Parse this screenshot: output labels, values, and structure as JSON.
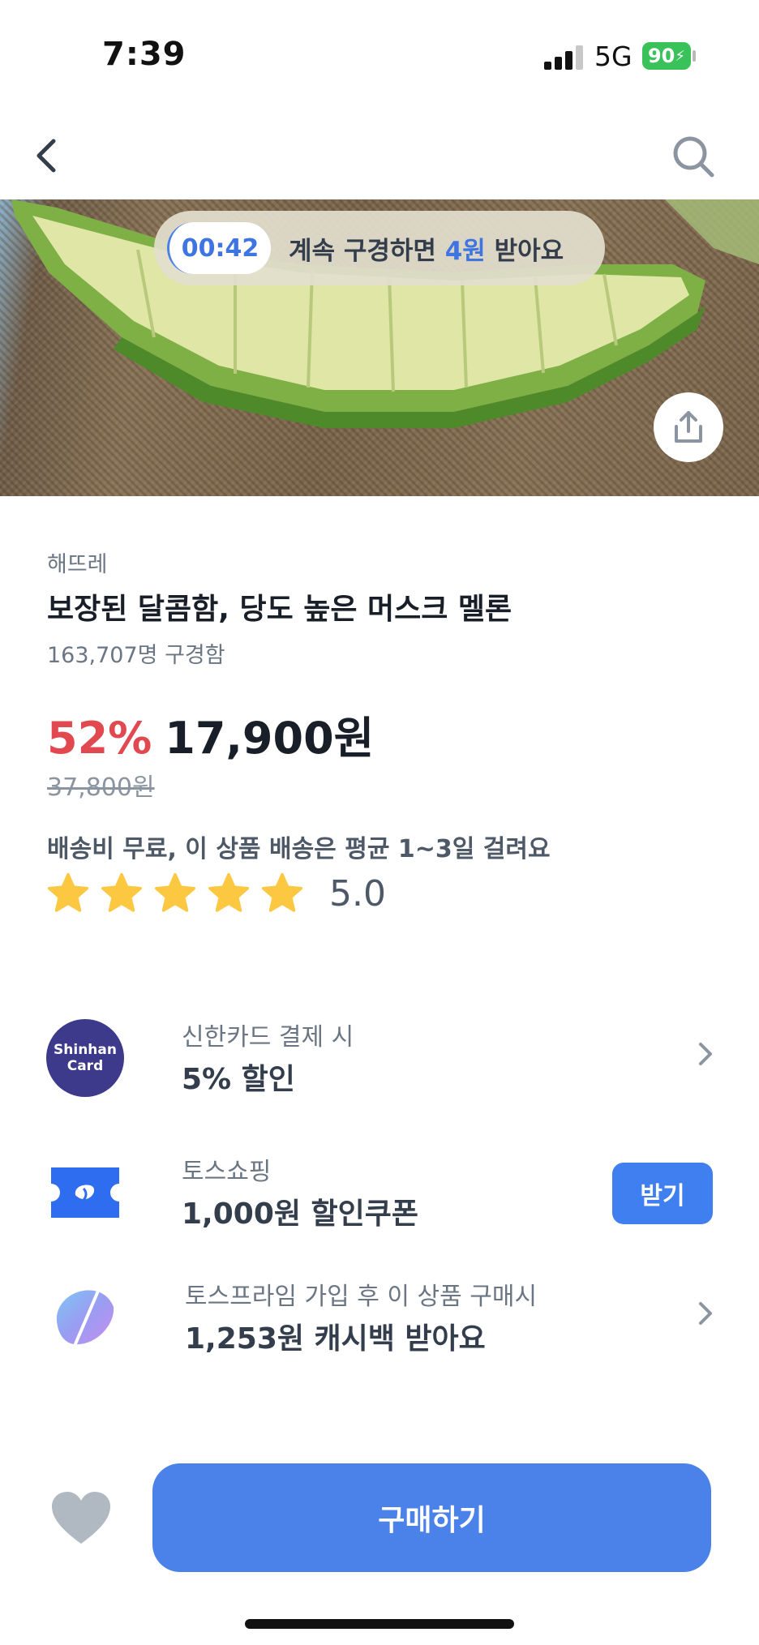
{
  "status_bar": {
    "time": "7:39",
    "network": "5G",
    "battery": "90"
  },
  "nav": {
    "back_icon": "chevron-left-icon",
    "search_icon": "search-icon"
  },
  "hero": {
    "timer": "00:42",
    "banner_prefix": "계속 구경하면 ",
    "banner_highlight": "4원",
    "banner_suffix": " 받아요",
    "share_icon": "share-icon"
  },
  "product": {
    "brand": "해뜨레",
    "title": "보장된 달콤함, 당도 높은 머스크 멜론",
    "views": "163,707명 구경함",
    "discount": "52%",
    "price": "17,900원",
    "original_price": "37,800원",
    "shipping": "배송비 무료, 이 상품 배송은 평균 1~3일 걸려요",
    "rating": "5.0",
    "stars": 5
  },
  "benefits": {
    "card": {
      "logo_line1": "Shinhan",
      "logo_line2": "Card",
      "sub": "신한카드 결제 시",
      "main": "5% 할인"
    },
    "coupon": {
      "sub": "토스쇼핑",
      "main": "1,000원 할인쿠폰",
      "button": "받기"
    },
    "prime": {
      "sub": "토스프라임 가입 후 이 상품 구매시",
      "main": "1,253원 캐시백 받아요"
    }
  },
  "bottom": {
    "buy_label": "구매하기",
    "wish_icon": "heart-icon"
  },
  "colors": {
    "accent": "#4b82ea",
    "discount": "#e2484f",
    "star": "#fcc842",
    "card_brand": "#3d3a8c"
  }
}
